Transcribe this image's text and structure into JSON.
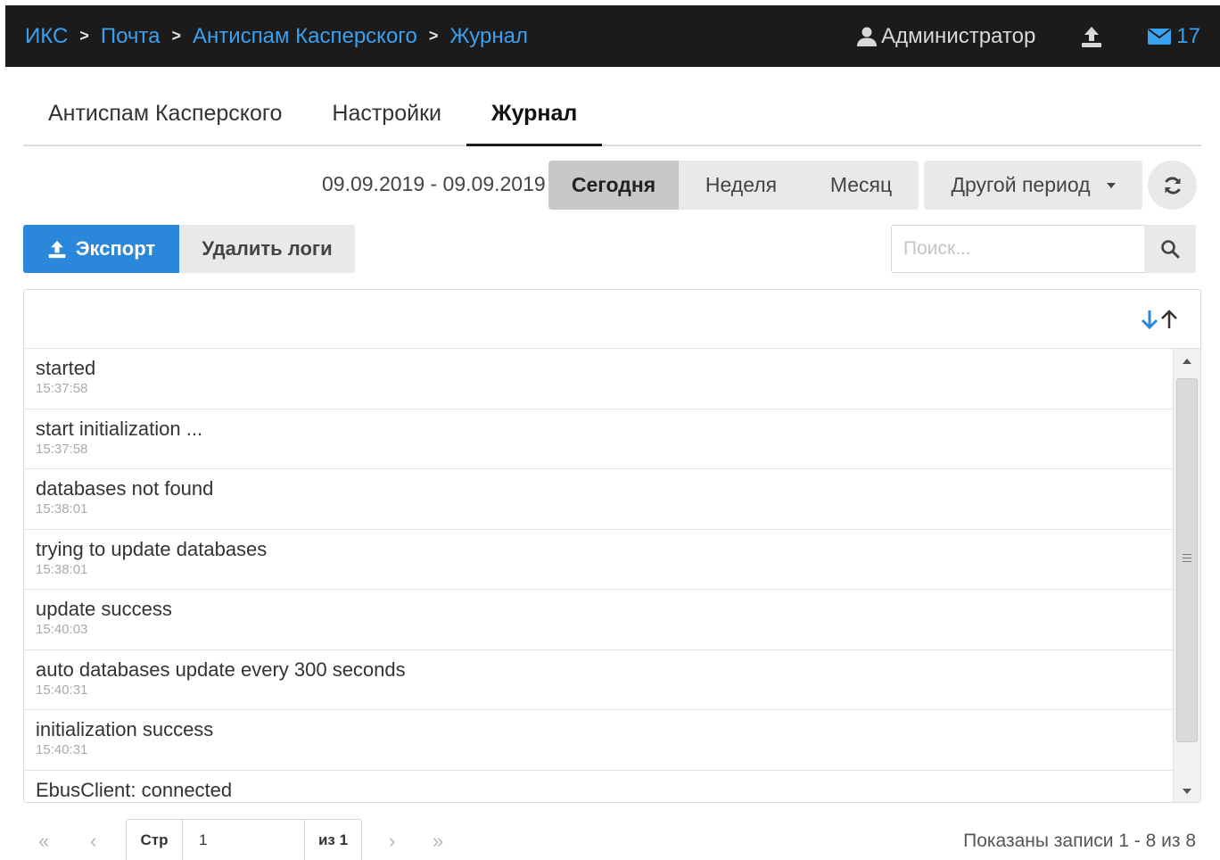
{
  "breadcrumbs": [
    "ИКС",
    "Почта",
    "Антиспам Касперского",
    "Журнал"
  ],
  "user": {
    "name": "Администратор"
  },
  "notifications": {
    "count": "17"
  },
  "tabs": [
    "Антиспам Касперского",
    "Настройки",
    "Журнал"
  ],
  "active_tab": "Журнал",
  "period": {
    "range": "09.09.2019 - 09.09.2019",
    "today": "Сегодня",
    "week": "Неделя",
    "month": "Месяц",
    "other": "Другой период",
    "selected": "Сегодня"
  },
  "actions": {
    "export": "Экспорт",
    "delete": "Удалить логи"
  },
  "search": {
    "placeholder": "Поиск...",
    "value": ""
  },
  "logs": [
    {
      "message": "started",
      "time": "15:37:58"
    },
    {
      "message": "start initialization ...",
      "time": "15:37:58"
    },
    {
      "message": "databases not found",
      "time": "15:38:01"
    },
    {
      "message": "trying to update databases",
      "time": "15:38:01"
    },
    {
      "message": "update success",
      "time": "15:40:03"
    },
    {
      "message": "auto databases update every 300 seconds",
      "time": "15:40:31"
    },
    {
      "message": "initialization success",
      "time": "15:40:31"
    },
    {
      "message": "EbusClient: connected",
      "time": ""
    }
  ],
  "pagination": {
    "first": "«",
    "prev": "‹",
    "next": "›",
    "last": "»",
    "page_label": "Стр",
    "page_value": "1",
    "of_label": "из 1",
    "records_text": "Показаны записи 1 - 8 из 8"
  },
  "colors": {
    "accent": "#3aa0f0",
    "primary_button": "#2b87d9",
    "topbar": "#1b1b1b"
  },
  "icons": [
    "user-icon",
    "upload-icon",
    "envelope-icon",
    "refresh-icon",
    "search-icon",
    "sort-icon"
  ]
}
